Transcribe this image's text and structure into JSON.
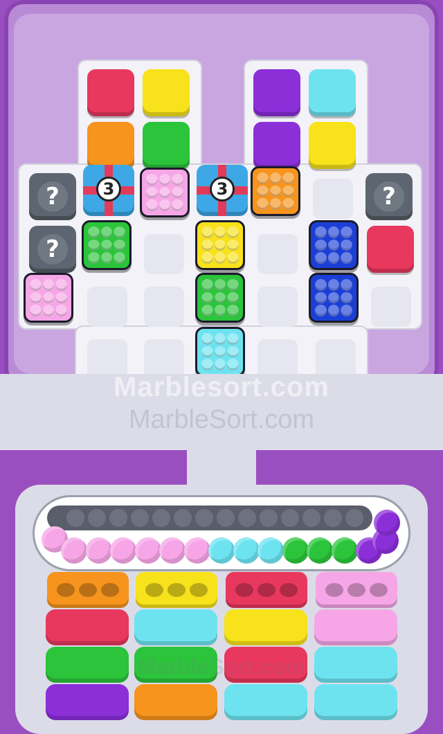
{
  "game": {
    "colors": {
      "red": "#e8385e",
      "yellow": "#f7e21b",
      "purple": "#8b2fd9",
      "cyan": "#6ee3f0",
      "orange": "#f6941d",
      "green": "#2bc43b",
      "pink": "#f6a6e6",
      "blue": "#1b3fd6",
      "mystery": "#5d6670",
      "gift": "#3ea8e6"
    },
    "mystery_label": "?",
    "gift_counts": [
      "3",
      "3"
    ],
    "watermark_main": "Marblesort.com",
    "watermark_secondary": "MarbleSort.com",
    "watermark_bottom": "MarbleSort.com",
    "marble_queue": [
      "pink",
      "pink",
      "pink",
      "pink",
      "pink",
      "pink",
      "pink",
      "cyan",
      "cyan",
      "cyan",
      "green",
      "green",
      "green",
      "purple",
      "purple",
      "purple"
    ],
    "tube_columns": [
      [
        "orange",
        "red",
        "green",
        "purple"
      ],
      [
        "yellow",
        "cyan",
        "green",
        "orange"
      ],
      [
        "red",
        "yellow",
        "red",
        "cyan"
      ],
      [
        "pink",
        "pink",
        "cyan",
        "cyan"
      ]
    ]
  }
}
